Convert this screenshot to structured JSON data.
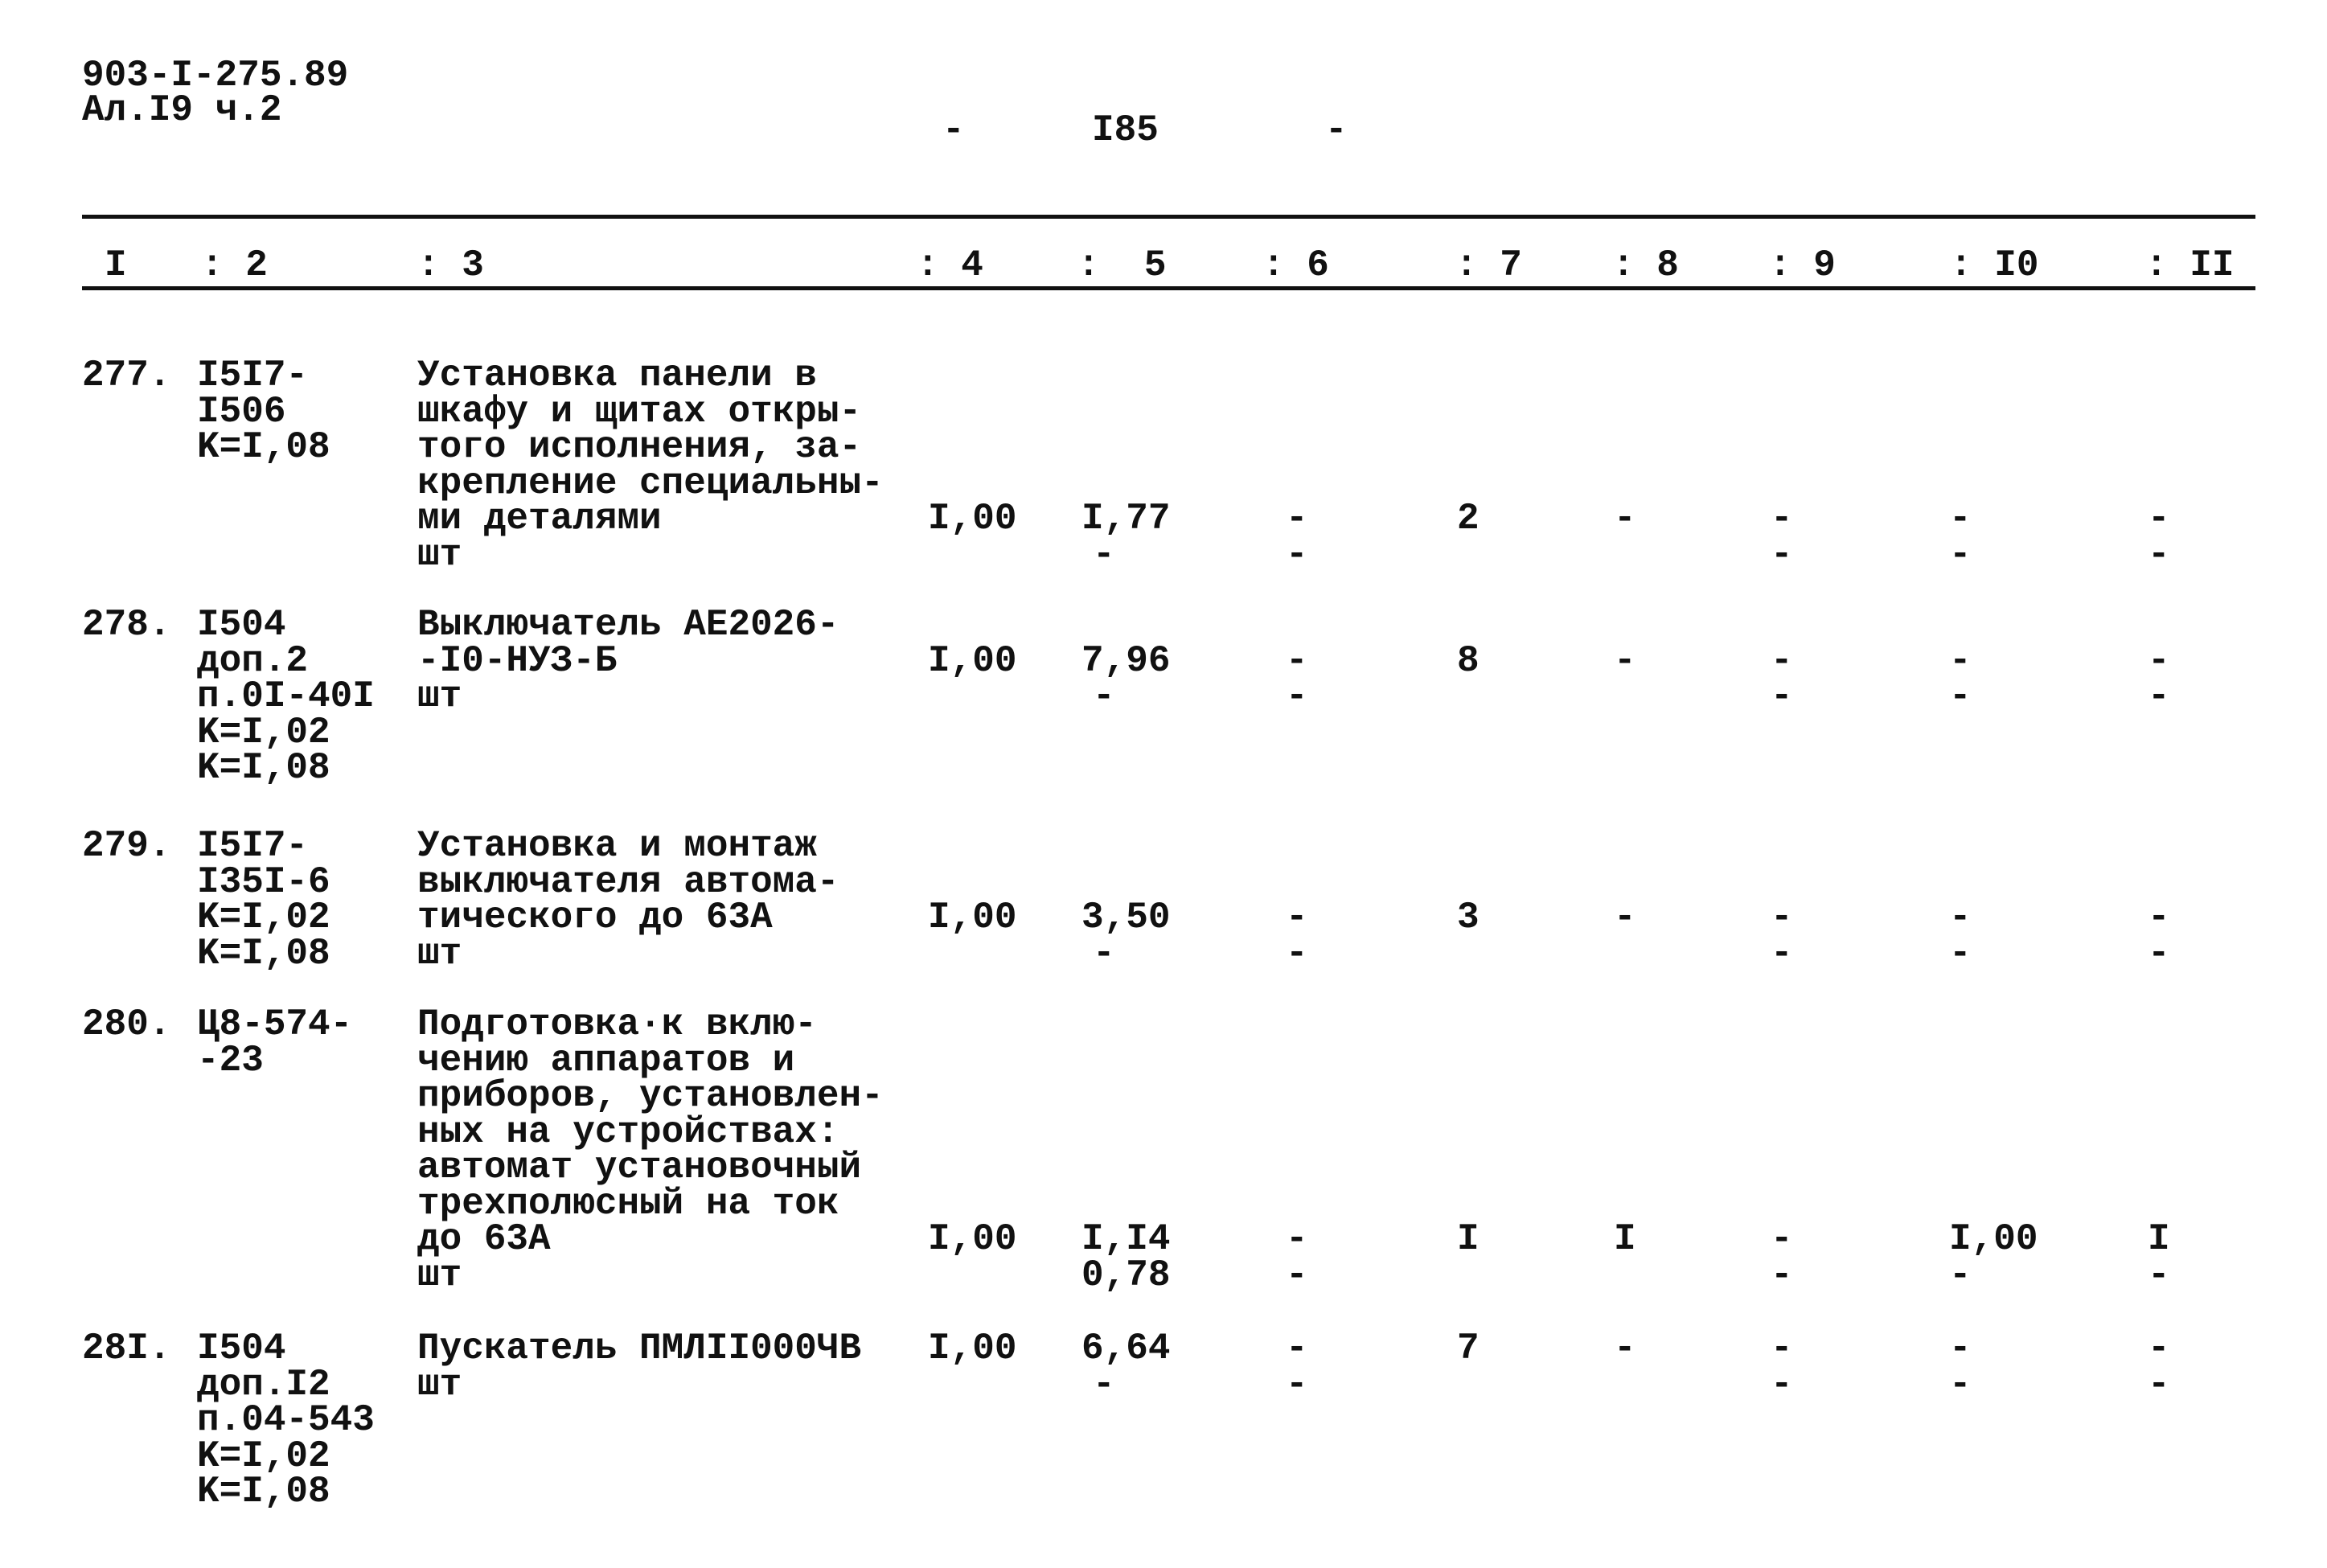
{
  "header": {
    "doc_code": "903-I-275.89",
    "album": "Ал.I9 ч.2",
    "page_dash_left": "-",
    "page_number": "I85",
    "page_dash_right": "-"
  },
  "columns": [
    "I",
    ": 2",
    ": 3",
    ": 4",
    ":  5",
    ": 6",
    ": 7",
    ": 8",
    ": 9",
    ": I0",
    ": II"
  ],
  "rows": [
    {
      "num": "277.",
      "code": [
        "I5I7-",
        "I506",
        "K=I,08"
      ],
      "desc": [
        "Установка панели в",
        "шкафу и щитах откры-",
        "того исполнения, за-",
        "крепление специальны-",
        "ми деталями",
        "шт"
      ],
      "values": [
        [
          "I,00",
          "I,77",
          "-",
          "2",
          "-",
          "-",
          "-",
          "-"
        ],
        [
          "",
          "-",
          "-",
          "",
          "",
          "-",
          "-",
          "-"
        ]
      ]
    },
    {
      "num": "278.",
      "code": [
        "I504",
        "доп.2",
        "п.0I-40I",
        "K=I,02",
        "K=I,08"
      ],
      "desc": [
        "Выключатель АЕ2026-",
        "-I0-НУЗ-Б",
        "шт"
      ],
      "values": [
        [
          "I,00",
          "7,96",
          "-",
          "8",
          "-",
          "-",
          "-",
          "-"
        ],
        [
          "",
          "-",
          "-",
          "",
          "",
          "-",
          "-",
          "-"
        ]
      ]
    },
    {
      "num": "279.",
      "code": [
        "I5I7-",
        "I35I-6",
        "K=I,02",
        "K=I,08"
      ],
      "desc": [
        "Установка и монтаж",
        "выключателя автома-",
        "тического до 63А",
        "шт"
      ],
      "values": [
        [
          "I,00",
          "3,50",
          "-",
          "3",
          "-",
          "-",
          "-",
          "-"
        ],
        [
          "",
          "-",
          "-",
          "",
          "",
          "-",
          "-",
          "-"
        ]
      ]
    },
    {
      "num": "280.",
      "code": [
        "Ц8-574-",
        "-23"
      ],
      "desc": [
        "Подготовка·к вклю-",
        "чению аппаратов и",
        "приборов, установлен-",
        "ных на устройствах:",
        "автомат установочный",
        "трехполюсный на ток",
        "до 63А",
        "шт"
      ],
      "values": [
        [
          "I,00",
          "I,I4",
          "-",
          "I",
          "I",
          "-",
          "I,00",
          "I"
        ],
        [
          "",
          "0,78",
          "-",
          "",
          "",
          "-",
          "-",
          "-"
        ]
      ]
    },
    {
      "num": "28I.",
      "code": [
        "I504",
        "доп.I2",
        "п.04-543",
        "K=I,02",
        "K=I,08"
      ],
      "desc": [
        "Пускатель ПМЛII000ЧВ",
        "шт"
      ],
      "values": [
        [
          "I,00",
          "6,64",
          "-",
          "7",
          "-",
          "-",
          "-",
          "-"
        ],
        [
          "",
          "-",
          "-",
          "",
          "",
          "-",
          "-",
          "-"
        ]
      ]
    }
  ]
}
